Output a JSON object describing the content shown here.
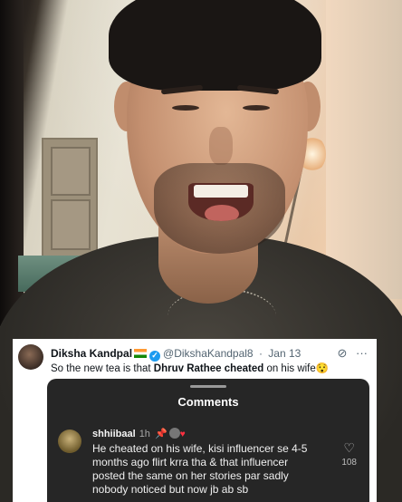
{
  "tweet": {
    "display_name": "Diksha Kandpal",
    "handle": "@DikshaKandpal8",
    "separator": "·",
    "date": "Jan 13",
    "text_before": "So the new tea is that ",
    "text_bold": "Dhruv Rathee",
    "text_middle": " ",
    "text_bold2": "cheated",
    "text_after": " on his wife",
    "emoji": "😯",
    "icons": {
      "grok": "⊘",
      "more": "···"
    }
  },
  "comments": {
    "title": "Comments",
    "items": [
      {
        "username": "shhiibaal",
        "time": "1h",
        "pin_glyph": "📌",
        "heart_glyph": "♥",
        "text": "He cheated on his wife, kisi influencer se 4-5 months ago flirt krra tha & that influencer posted the same on her stories par sadly nobody noticed but now jb ab sb",
        "like_icon": "♡",
        "likes": "108"
      }
    ]
  }
}
